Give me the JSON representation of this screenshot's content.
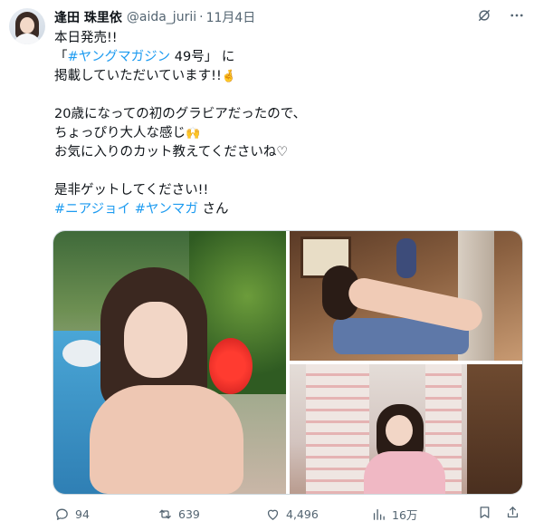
{
  "tweet": {
    "display_name": "逢田 珠里依",
    "handle": "@aida_jurii",
    "separator": "·",
    "date": "11月4日",
    "lines": {
      "l1": "本日発売!!",
      "l2_pre": "「",
      "l2_tag": "#ヤングマガジン",
      "l2_post": " 49号」 に",
      "l3": "掲載していただいています!!",
      "l3_emoji": "🤞",
      "l4": "20歳になっての初のグラビアだったので、",
      "l5": "ちょっぴり大人な感じ",
      "l5_emoji": "🙌",
      "l6": "お気に入りのカット教えてくださいね♡",
      "l7": "是非ゲットしてください!!",
      "l8_tag1": "#ニアジョイ",
      "l8_tag2": "#ヤンマガ",
      "l8_post": " さん"
    },
    "icons": {
      "grok": "grok-icon",
      "more": "more-icon"
    }
  },
  "media": {
    "photos": [
      "main-photo",
      "top-right-photo",
      "bottom-right-photo"
    ]
  },
  "stats": {
    "replies": "94",
    "reposts": "639",
    "likes": "4,496",
    "views": "16万"
  },
  "colors": {
    "link": "#1d9bf0",
    "secondary": "#536471",
    "text": "#0f1419"
  }
}
